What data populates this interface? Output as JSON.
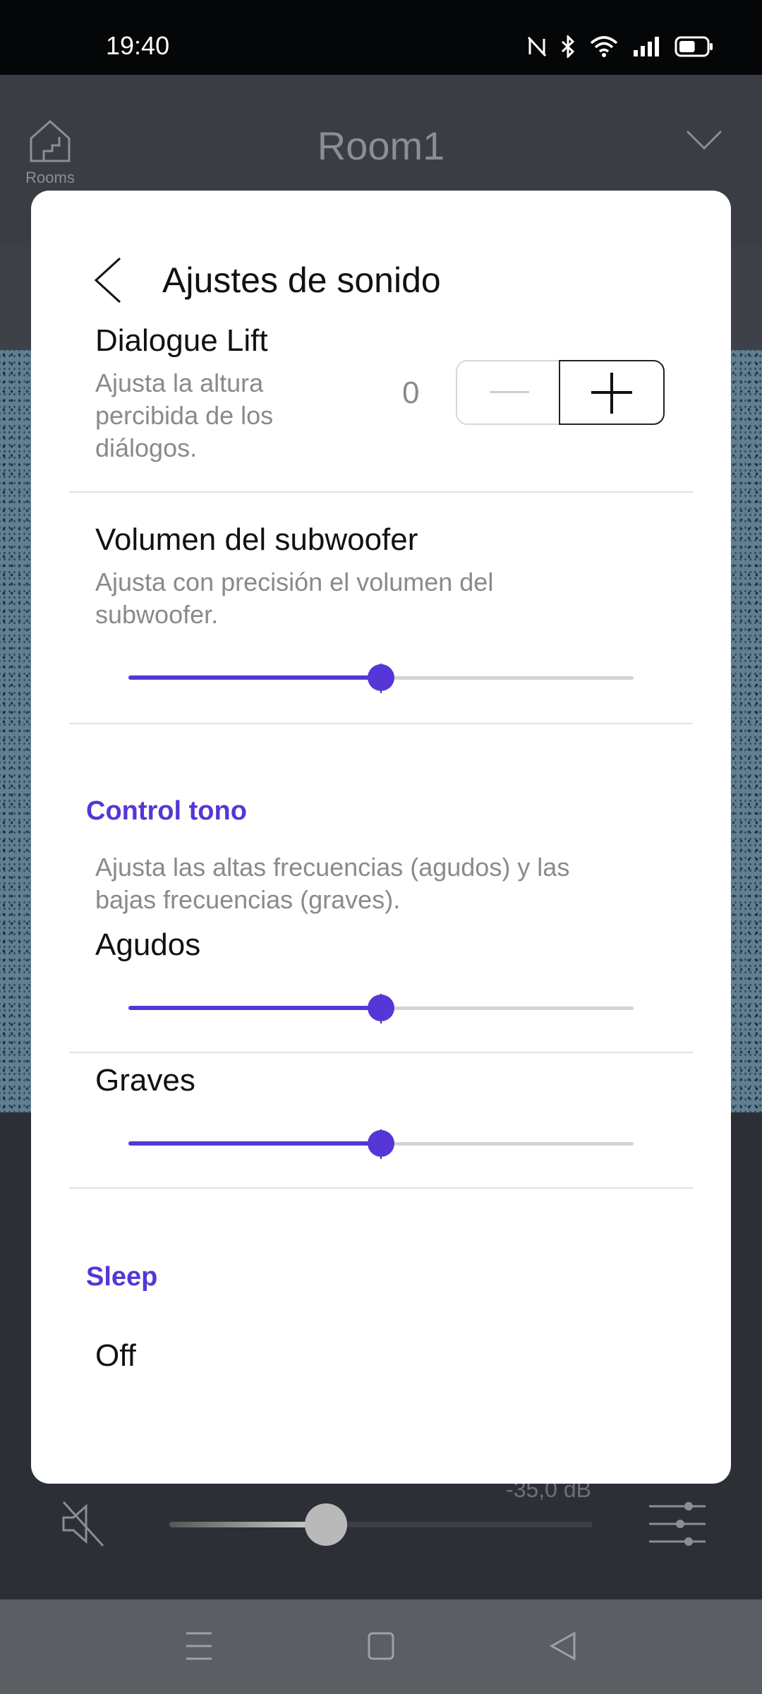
{
  "status_bar": {
    "time": "19:40",
    "icons": [
      "nfc-icon",
      "bluetooth-icon",
      "wifi-icon",
      "signal-icon",
      "battery-icon"
    ],
    "battery_level": 0.6
  },
  "app_header": {
    "rooms_label": "Rooms",
    "room_name": "Room1"
  },
  "dialog": {
    "title": "Ajustes de sonido",
    "dialogue_lift": {
      "title": "Dialogue Lift",
      "description_lines": [
        "Ajusta la altura",
        "percibida de los",
        "diálogos."
      ],
      "value": "0"
    },
    "subwoofer": {
      "title": "Volumen del subwoofer",
      "description_lines": [
        "Ajusta con precisión el volumen del",
        "subwoofer."
      ],
      "level": 0.5
    },
    "tone_control": {
      "heading": "Control tono",
      "description_lines": [
        "Ajusta las altas frecuencias (agudos) y las",
        "bajas frecuencias (graves)."
      ],
      "treble": {
        "title": "Agudos",
        "level": 0.5
      },
      "bass": {
        "title": "Graves",
        "level": 0.5
      }
    },
    "sleep": {
      "heading": "Sleep",
      "value": "Off"
    }
  },
  "player": {
    "volume_db": "-35,0 dB",
    "volume_level": 0.37
  },
  "colors": {
    "accent": "#5636d6",
    "dialog_bg": "#ffffff",
    "status_bar_bg": "#050608",
    "nav_bar_bg": "#5b5e63"
  },
  "nav_bar": {
    "buttons": [
      "menu-icon",
      "home-icon",
      "back-icon"
    ]
  }
}
